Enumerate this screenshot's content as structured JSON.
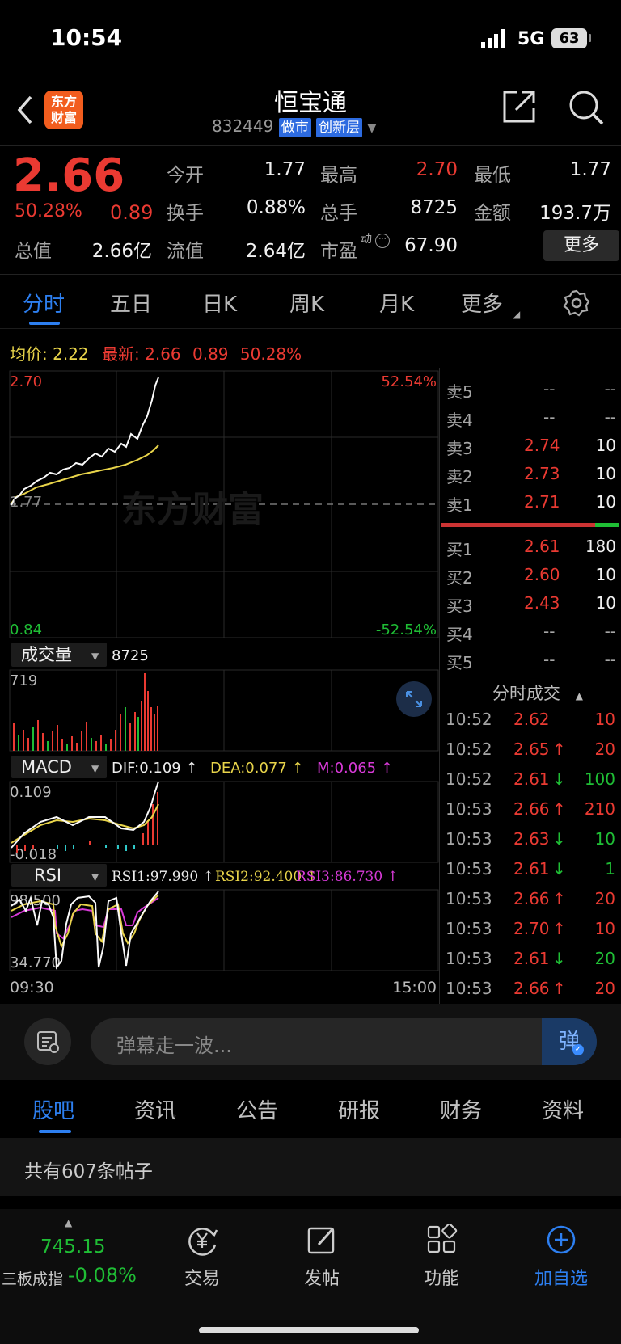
{
  "status": {
    "time": "10:54",
    "network": "5G",
    "battery": "63"
  },
  "header": {
    "title": "恒宝通",
    "code": "832449",
    "tags": [
      "做市",
      "创新层"
    ],
    "logo_text": [
      "东方",
      "财富"
    ]
  },
  "quote": {
    "price": "2.66",
    "change_pct": "50.28%",
    "change": "0.89",
    "fields": [
      {
        "label": "今开",
        "value": "1.77"
      },
      {
        "label": "最高",
        "value": "2.70"
      },
      {
        "label": "最低",
        "value": "1.77"
      },
      {
        "label": "换手",
        "value": "0.88%"
      },
      {
        "label": "总手",
        "value": "8725"
      },
      {
        "label": "金额",
        "value": "193.7万"
      },
      {
        "label": "总值",
        "value": "2.66亿"
      },
      {
        "label": "流值",
        "value": "2.64亿"
      },
      {
        "label": "市盈",
        "value": "67.90",
        "sup": "动"
      }
    ],
    "more": "更多"
  },
  "chart_tabs": [
    "分时",
    "五日",
    "日K",
    "周K",
    "月K",
    "更多"
  ],
  "intraday": {
    "legend": {
      "avg_label": "均价:",
      "avg": "2.22",
      "last_label": "最新:",
      "last": "2.66",
      "chg": "0.89",
      "pct": "50.28%"
    },
    "price_top": "2.70",
    "price_mid": "1.77",
    "price_bottom": "0.84",
    "pct_top": "52.54%",
    "pct_bottom": "-52.54%",
    "watermark": "东方财富",
    "volume": {
      "label": "成交量",
      "total": "8725",
      "max": "719"
    },
    "macd": {
      "label": "MACD",
      "dif": "DIF:0.109 ↑",
      "dea": "DEA:0.077 ↑",
      "m": "M:0.065 ↑",
      "top": "0.109",
      "bottom": "-0.018"
    },
    "rsi": {
      "label": "RSI",
      "rsi1": "RSI1:97.990 ↑",
      "rsi2": "RSI2:92.400 ↑",
      "rsi3": "RSI3:86.730 ↑",
      "top": "98.500",
      "bottom": "34.770"
    },
    "time_start": "09:30",
    "time_end": "15:00"
  },
  "order_book": {
    "asks": [
      {
        "label": "卖5",
        "price": "--",
        "vol": "--"
      },
      {
        "label": "卖4",
        "price": "--",
        "vol": "--"
      },
      {
        "label": "卖3",
        "price": "2.74",
        "vol": "10"
      },
      {
        "label": "卖2",
        "price": "2.73",
        "vol": "10"
      },
      {
        "label": "卖1",
        "price": "2.71",
        "vol": "10"
      }
    ],
    "bids": [
      {
        "label": "买1",
        "price": "2.61",
        "vol": "180"
      },
      {
        "label": "买2",
        "price": "2.60",
        "vol": "10"
      },
      {
        "label": "买3",
        "price": "2.43",
        "vol": "10"
      },
      {
        "label": "买4",
        "price": "--",
        "vol": "--"
      },
      {
        "label": "买5",
        "price": "--",
        "vol": "--"
      }
    ]
  },
  "trades": {
    "title": "分时成交",
    "rows": [
      {
        "time": "10:52",
        "price": "2.62",
        "dir": "",
        "vol": "10",
        "color": "red"
      },
      {
        "time": "10:52",
        "price": "2.65",
        "dir": "↑",
        "vol": "20",
        "color": "red"
      },
      {
        "time": "10:52",
        "price": "2.61",
        "dir": "↓",
        "vol": "100",
        "color": "green"
      },
      {
        "time": "10:53",
        "price": "2.66",
        "dir": "↑",
        "vol": "210",
        "color": "red"
      },
      {
        "time": "10:53",
        "price": "2.63",
        "dir": "↓",
        "vol": "10",
        "color": "green"
      },
      {
        "time": "10:53",
        "price": "2.61",
        "dir": "↓",
        "vol": "1",
        "color": "green"
      },
      {
        "time": "10:53",
        "price": "2.66",
        "dir": "↑",
        "vol": "20",
        "color": "red"
      },
      {
        "time": "10:53",
        "price": "2.70",
        "dir": "↑",
        "vol": "10",
        "color": "red"
      },
      {
        "time": "10:53",
        "price": "2.61",
        "dir": "↓",
        "vol": "20",
        "color": "green"
      },
      {
        "time": "10:53",
        "price": "2.66",
        "dir": "↑",
        "vol": "20",
        "color": "red"
      }
    ]
  },
  "danmu": {
    "placeholder": "弹幕走一波...",
    "button": "弹"
  },
  "bottom_tabs": [
    "股吧",
    "资讯",
    "公告",
    "研报",
    "财务",
    "资料"
  ],
  "posts": {
    "count_text": "共有607条帖子"
  },
  "index": {
    "value": "745.15",
    "name": "三板成指",
    "pct": "-0.08%"
  },
  "nav": [
    {
      "label": "交易",
      "icon": "yen-exchange-icon"
    },
    {
      "label": "发帖",
      "icon": "edit-icon"
    },
    {
      "label": "功能",
      "icon": "grid-icon"
    },
    {
      "label": "加自选",
      "icon": "plus-circle-icon"
    }
  ],
  "colors": {
    "up": "#ea3a32",
    "down": "#1fbe35",
    "avg": "#e8d44a",
    "accent": "#2d7ff0"
  }
}
